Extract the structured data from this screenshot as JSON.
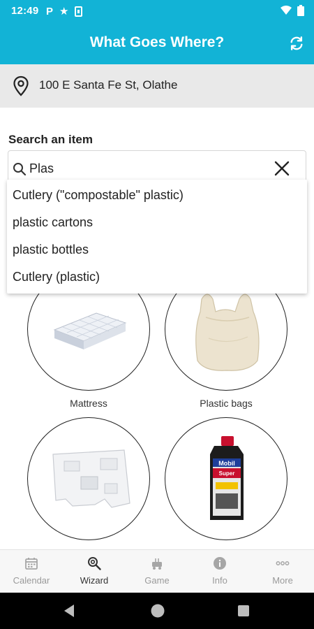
{
  "status_bar": {
    "time": "12:49",
    "parking_glyph": "P",
    "icons": [
      "parking-icon",
      "star-icon",
      "sim-icon",
      "wifi-icon",
      "battery-icon"
    ]
  },
  "app_bar": {
    "title": "What Goes Where?",
    "refresh_icon": "refresh-icon",
    "background": "#12b3d6"
  },
  "location": {
    "address": "100 E Santa Fe St, Olathe",
    "icon": "location-pin-icon"
  },
  "search": {
    "label": "Search an item",
    "value": "Plas",
    "suggestions": [
      "Cutlery (\"compostable\" plastic)",
      "plastic cartons",
      "plastic bottles",
      "Cutlery (plastic)"
    ]
  },
  "items": [
    {
      "label": "Mattress",
      "icon": "mattress-image"
    },
    {
      "label": "Plastic bags",
      "icon": "plastic-bag-image"
    },
    {
      "label": "",
      "icon": "foam-packaging-image"
    },
    {
      "label": "",
      "icon": "motor-oil-bottle-image"
    }
  ],
  "oil_bottle_text": {
    "brand": "Mobil",
    "sub": "Super"
  },
  "bottom_nav": [
    {
      "label": "Calendar",
      "icon": "calendar-icon",
      "active": false
    },
    {
      "label": "Wizard",
      "icon": "wizard-search-icon",
      "active": true
    },
    {
      "label": "Game",
      "icon": "game-icon",
      "active": false
    },
    {
      "label": "Info",
      "icon": "info-icon",
      "active": false
    },
    {
      "label": "More",
      "icon": "more-icon",
      "active": false
    }
  ]
}
